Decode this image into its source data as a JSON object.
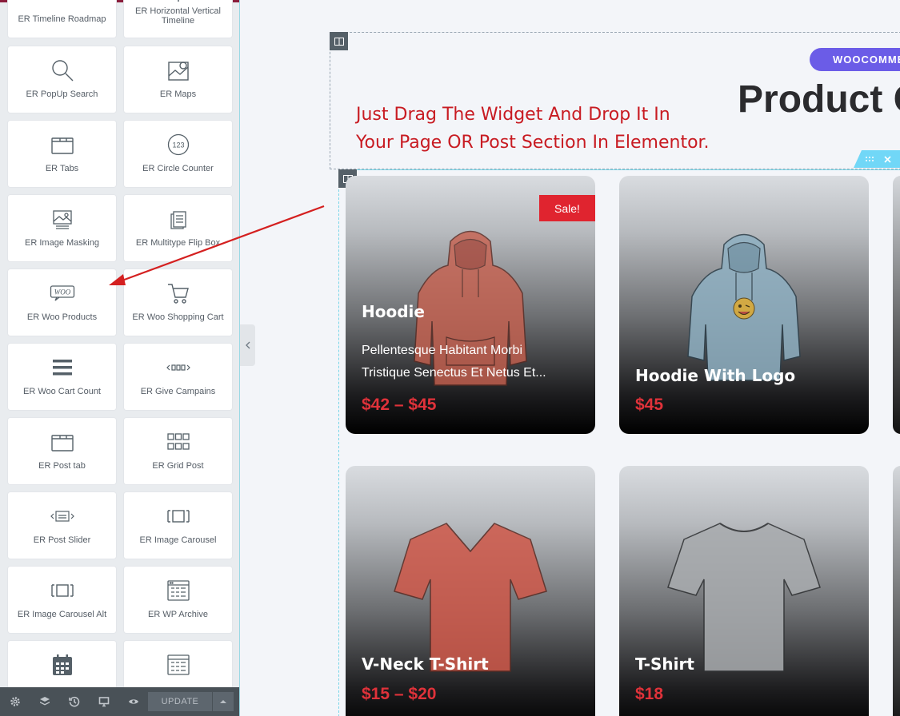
{
  "panel": {
    "widgets": [
      {
        "label": "ER Timeline Roadmap",
        "icon": "timeline-icon"
      },
      {
        "label": "ER Horizontal Vertical Timeline",
        "icon": "horizontal-timeline-icon"
      },
      {
        "label": "ER PopUp Search",
        "icon": "search-icon"
      },
      {
        "label": "ER Maps",
        "icon": "map-icon"
      },
      {
        "label": "ER Tabs",
        "icon": "tabs-icon"
      },
      {
        "label": "ER Circle Counter",
        "icon": "counter-icon",
        "icon_text": "123"
      },
      {
        "label": "ER Image Masking",
        "icon": "image-icon"
      },
      {
        "label": "ER Multitype Flip Box",
        "icon": "flip-box-icon"
      },
      {
        "label": "ER Woo Products",
        "icon": "woo-icon",
        "icon_text": "WOO"
      },
      {
        "label": "ER Woo Shopping Cart",
        "icon": "cart-icon"
      },
      {
        "label": "ER Woo Cart Count",
        "icon": "menu-lines-icon"
      },
      {
        "label": "ER Give Campains",
        "icon": "slides-icon"
      },
      {
        "label": "ER Post tab",
        "icon": "tabs-icon"
      },
      {
        "label": "ER Grid Post",
        "icon": "grid-icon"
      },
      {
        "label": "ER Post Slider",
        "icon": "slider-icon"
      },
      {
        "label": "ER Image Carousel",
        "icon": "carousel-icon"
      },
      {
        "label": "ER Image Carousel Alt",
        "icon": "carousel-icon"
      },
      {
        "label": "ER WP Archive",
        "icon": "archive-icon"
      },
      {
        "label": "",
        "icon": "calendar-icon"
      },
      {
        "label": "",
        "icon": "archive-icon"
      }
    ],
    "footer": {
      "icons": [
        "gear-icon",
        "layers-icon",
        "history-icon",
        "responsive-icon",
        "eye-icon"
      ],
      "update_label": "UPDATE"
    }
  },
  "canvas": {
    "badge": "WOOCOMME",
    "title": "Product C",
    "annotation_line1": "Just Drag The Widget And Drop It In",
    "annotation_line2": "Your Page OR Post Section In Elementor.",
    "products": [
      {
        "name": "Hoodie",
        "description_line1": "Pellentesque Habitant Morbi",
        "description_line2": "Tristique Senectus Et Netus Et...",
        "price": "$42 – $45",
        "sale": "Sale!"
      },
      {
        "name": "Hoodie With Logo",
        "price": "$45"
      },
      {
        "name": "V-Neck T-Shirt",
        "price": "$15 – $20"
      },
      {
        "name": "T-Shirt",
        "price": "$18"
      }
    ]
  },
  "colors": {
    "accent_red": "#e0242f",
    "badge_purple": "#6b5ce7",
    "annotation_red": "#c81b22",
    "editor_dark": "#495157"
  }
}
